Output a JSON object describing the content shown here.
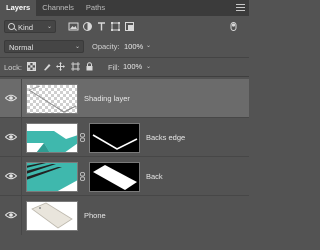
{
  "tabs": [
    {
      "label": "Layers",
      "active": true
    },
    {
      "label": "Channels",
      "active": false
    },
    {
      "label": "Paths",
      "active": false
    }
  ],
  "filter": {
    "kind_label": "Kind",
    "icons": [
      "image-filter-icon",
      "adjustment-filter-icon",
      "type-filter-icon",
      "shape-filter-icon",
      "smart-object-filter-icon",
      "filter-toggle-icon"
    ]
  },
  "blend": {
    "mode": "Normal",
    "opacity_label": "Opacity:",
    "opacity_value": "100%"
  },
  "lock": {
    "label": "Lock:",
    "icons": [
      "lock-transparent-pixels-icon",
      "lock-image-pixels-icon",
      "lock-position-icon",
      "lock-artboard-icon",
      "lock-all-icon"
    ],
    "fill_label": "Fill:",
    "fill_value": "100%"
  },
  "layers": [
    {
      "name": "Shading layer",
      "visible": true,
      "selected": true,
      "has_mask": false
    },
    {
      "name": "Backs edge",
      "visible": true,
      "selected": false,
      "has_mask": true
    },
    {
      "name": "Back",
      "visible": true,
      "selected": false,
      "has_mask": true
    },
    {
      "name": "Phone",
      "visible": true,
      "selected": false,
      "has_mask": false
    }
  ],
  "colors": {
    "panel_bg": "#535353",
    "tab_bar_bg": "#3b3b3b",
    "selected_row": "#6b6b6b",
    "teal_accent": "#3fb8ad"
  }
}
